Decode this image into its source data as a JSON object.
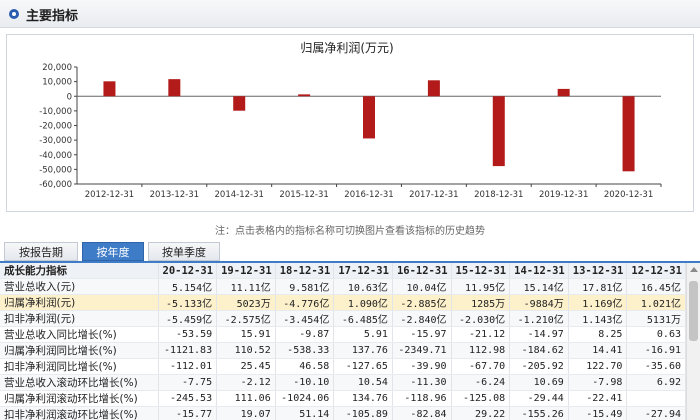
{
  "header": {
    "title": "主要指标"
  },
  "chart_data": {
    "type": "bar",
    "title": "归属净利润(万元)",
    "categories": [
      "2012-12-31",
      "2013-12-31",
      "2014-12-31",
      "2015-12-31",
      "2016-12-31",
      "2017-12-31",
      "2018-12-31",
      "2019-12-31",
      "2020-12-31"
    ],
    "values": [
      10210,
      11690,
      -9884,
      1285,
      -28850,
      10900,
      -47760,
      5023,
      -51330
    ],
    "y_ticks": [
      "20,000",
      "10,000",
      "0",
      "-10,000",
      "-20,000",
      "-30,000",
      "-40,000",
      "-50,000",
      "-60,000"
    ],
    "ylim": [
      -60000,
      20000
    ],
    "bar_color": "#b31b1b",
    "grid": false,
    "legend": "none"
  },
  "chart_note": "注：点击表格内的指标名称可切换图片查看该指标的历史趋势",
  "tabs": [
    {
      "label": "按报告期",
      "active": false
    },
    {
      "label": "按年度",
      "active": true
    },
    {
      "label": "按单季度",
      "active": false
    }
  ],
  "table": {
    "header_label": "成长能力指标",
    "columns": [
      "20-12-31",
      "19-12-31",
      "18-12-31",
      "17-12-31",
      "16-12-31",
      "15-12-31",
      "14-12-31",
      "13-12-31",
      "12-12-31"
    ],
    "rows": [
      {
        "label": "营业总收入(元)",
        "values": [
          "5.154亿",
          "11.11亿",
          "9.581亿",
          "10.63亿",
          "10.04亿",
          "11.95亿",
          "15.14亿",
          "17.81亿",
          "16.45亿"
        ]
      },
      {
        "label": "归属净利润(元)",
        "values": [
          "-5.133亿",
          "5023万",
          "-4.776亿",
          "1.090亿",
          "-2.885亿",
          "1285万",
          "-9884万",
          "1.169亿",
          "1.021亿"
        ]
      },
      {
        "label": "扣非净利润(元)",
        "values": [
          "-5.459亿",
          "-2.575亿",
          "-3.454亿",
          "-6.485亿",
          "-2.840亿",
          "-2.030亿",
          "-1.210亿",
          "1.143亿",
          "5131万"
        ]
      },
      {
        "label": "营业总收入同比增长(%)",
        "values": [
          "-53.59",
          "15.91",
          "-9.87",
          "5.91",
          "-15.97",
          "-21.12",
          "-14.97",
          "8.25",
          "0.63"
        ]
      },
      {
        "label": "归属净利润同比增长(%)",
        "values": [
          "-1121.83",
          "110.52",
          "-538.33",
          "137.76",
          "-2349.71",
          "112.98",
          "-184.62",
          "14.41",
          "-16.91"
        ]
      },
      {
        "label": "扣非净利润同比增长(%)",
        "values": [
          "-112.01",
          "25.45",
          "46.58",
          "-127.65",
          "-39.90",
          "-67.70",
          "-205.92",
          "122.70",
          "-35.60"
        ]
      },
      {
        "label": "营业总收入滚动环比增长(%)",
        "values": [
          "-7.75",
          "-2.12",
          "-10.10",
          "10.54",
          "-11.30",
          "-6.24",
          "10.69",
          "-7.98",
          "6.92"
        ]
      },
      {
        "label": "归属净利润滚动环比增长(%)",
        "values": [
          "-245.53",
          "111.06",
          "-1024.06",
          "134.76",
          "-118.96",
          "-125.08",
          "-29.44",
          "-22.41"
        ]
      },
      {
        "label": "扣非净利润滚动环比增长(%)",
        "values": [
          "-15.77",
          "19.07",
          "51.14",
          "-105.89",
          "-82.84",
          "29.22",
          "-155.26",
          "-15.49",
          "-27.94"
        ]
      }
    ]
  }
}
